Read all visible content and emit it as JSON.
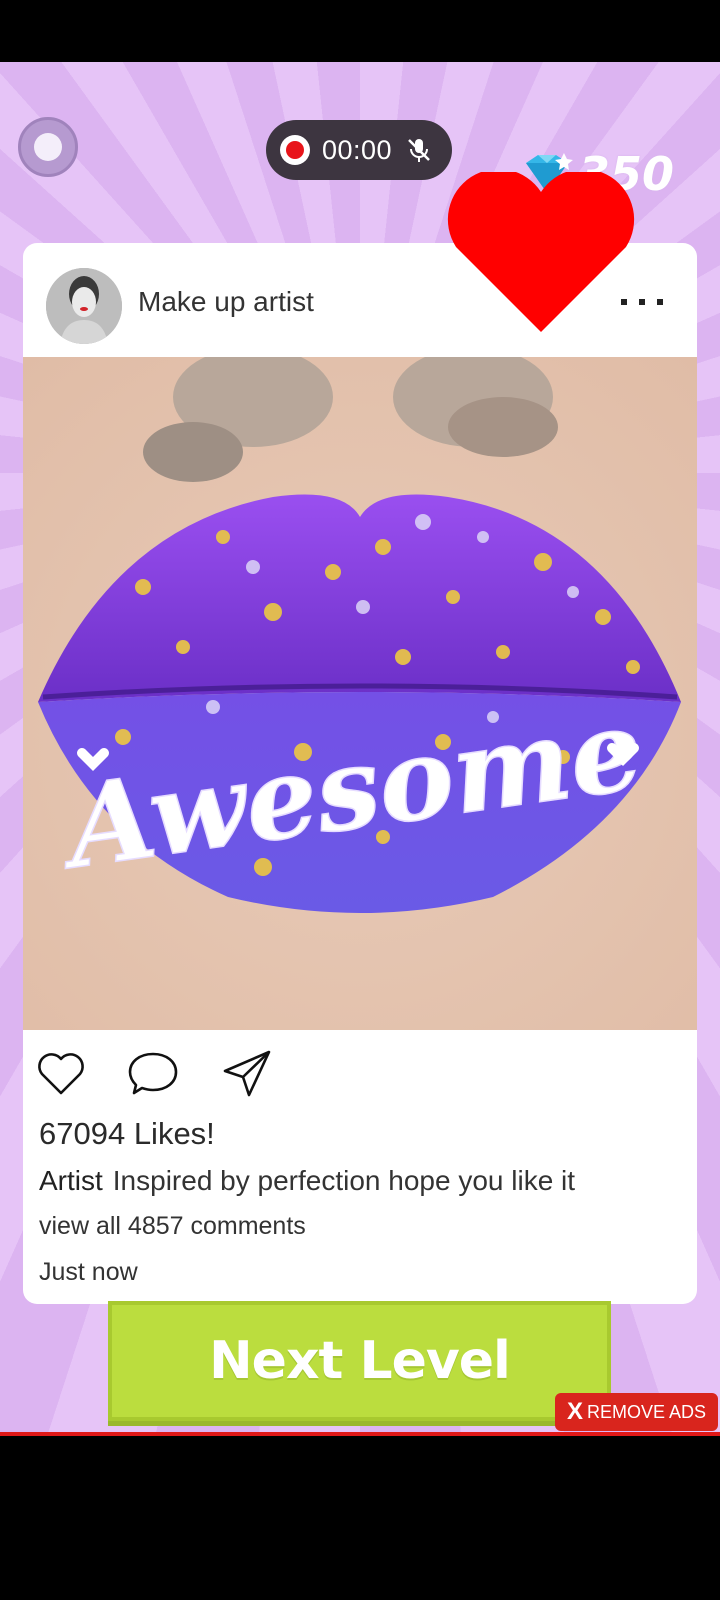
{
  "hud": {
    "record_timer": "00:00",
    "gems": "350"
  },
  "post": {
    "author": "Make up artist",
    "image_text": "Awesome",
    "likes": "67094 Likes!",
    "caption_user": "Artist",
    "caption_text": "Inspired by perfection hope you like it",
    "comments_link": "view all 4857 comments",
    "timestamp": "Just now"
  },
  "buttons": {
    "next_level": "Next Level",
    "remove_ads_x": "X",
    "remove_ads": "REMOVE ADS"
  },
  "icons": {
    "record": "record-button-icon",
    "mic_off": "mic-off-icon",
    "gem": "diamond-gem-icon",
    "heart": "heart-icon",
    "more": "more-options-icon",
    "like": "like-heart-icon",
    "comment": "comment-bubble-icon",
    "share": "send-share-icon"
  },
  "colors": {
    "background": "#e6c4f7",
    "next_button": "#bbdd3e",
    "remove_ads": "#d9251d",
    "heart": "#ff0000",
    "lip_purple": "#7a3fe0"
  }
}
